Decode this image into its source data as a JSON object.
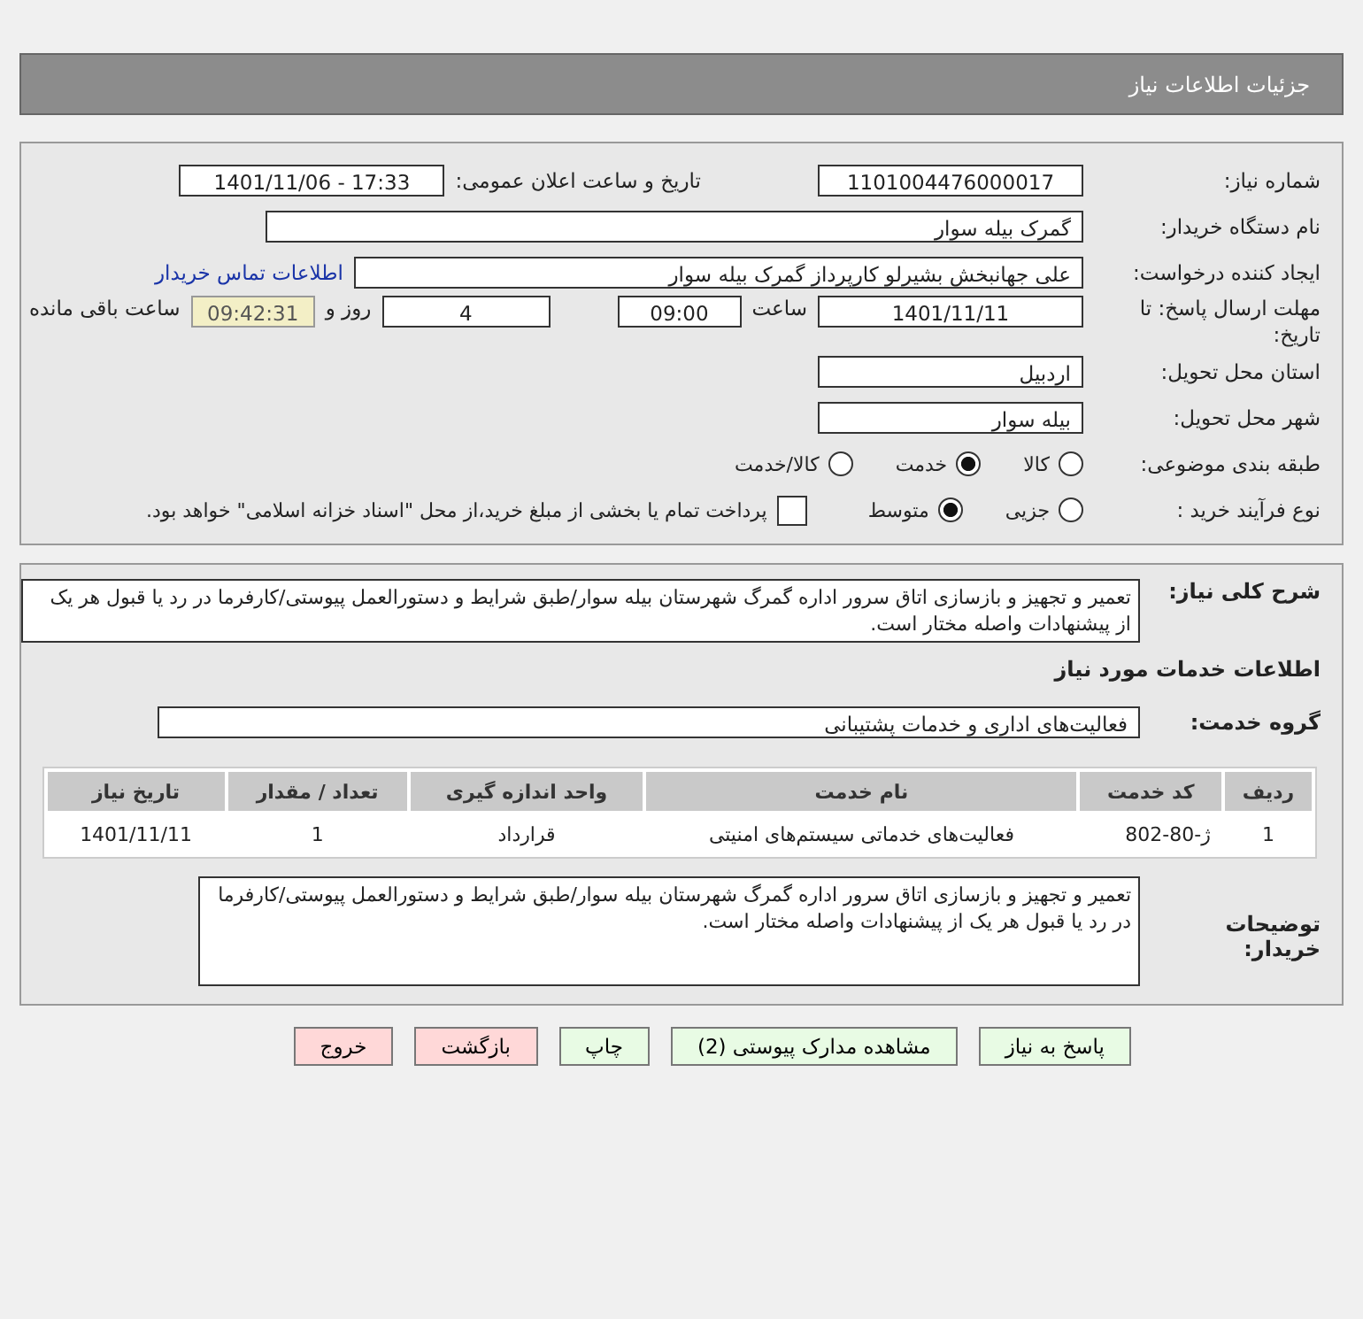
{
  "header": {
    "title": "جزئیات اطلاعات نیاز"
  },
  "need_number": {
    "label": "شماره نیاز:",
    "value": "1101004476000017"
  },
  "announce_date": {
    "label": "تاریخ و ساعت اعلان عمومی:",
    "value": "1401/11/06 - 17:33"
  },
  "buyer_org": {
    "label": "نام دستگاه خریدار:",
    "value": "گمرک بیله سوار"
  },
  "requester": {
    "label": "ایجاد کننده درخواست:",
    "value": "علی جهانبخش بشیرلو کارپرداز گمرک بیله سوار",
    "link": "اطلاعات تماس خریدار"
  },
  "deadline": {
    "label": "مهلت ارسال پاسخ: تا تاریخ:",
    "date": "1401/11/11",
    "time_label": "ساعت",
    "time": "09:00",
    "days": "4",
    "days_label": "روز و",
    "remaining": "09:42:31",
    "remaining_label": "ساعت باقی مانده"
  },
  "province": {
    "label": "استان محل تحویل:",
    "value": "اردبیل"
  },
  "city": {
    "label": "شهر محل تحویل:",
    "value": "بیله سوار"
  },
  "category": {
    "label": "طبقه بندی موضوعی:",
    "options": [
      {
        "label": "کالا",
        "selected": false
      },
      {
        "label": "خدمت",
        "selected": true
      },
      {
        "label": "کالا/خدمت",
        "selected": false
      }
    ]
  },
  "purchase": {
    "label": "نوع فرآیند خرید :",
    "options": [
      {
        "label": "جزیی",
        "selected": false
      },
      {
        "label": "متوسط",
        "selected": true
      }
    ],
    "treasury": {
      "checked": false,
      "text": "پرداخت تمام یا بخشی از مبلغ خرید،از محل \"اسناد خزانه اسلامی\" خواهد بود."
    }
  },
  "description": {
    "label": "شرح کلی نیاز:",
    "value": "تعمیر و تجهیز و بازسازی اتاق سرور اداره گمرگ شهرستان بیله سوار/طبق شرایط و دستورالعمل پیوستی/کارفرما در رد یا قبول هر یک از پیشنهادات واصله مختار است."
  },
  "services_heading": "اطلاعات خدمات مورد نیاز",
  "service_group": {
    "label": "گروه خدمت:",
    "value": "فعالیت‌های اداری و خدمات پشتیبانی"
  },
  "table": {
    "columns": [
      "ردیف",
      "کد خدمت",
      "نام خدمت",
      "واحد اندازه گیری",
      "تعداد / مقدار",
      "تاریخ نیاز"
    ],
    "rows": [
      [
        "1",
        "ژ-80-802",
        "فعالیت‌های خدماتی سیستم‌های امنیتی",
        "قرارداد",
        "1",
        "1401/11/11"
      ]
    ]
  },
  "buyer_notes": {
    "label": "توضیحات خریدار:",
    "value": "تعمیر و تجهیز و بازسازی اتاق سرور اداره گمرگ شهرستان بیله سوار/طبق شرایط و دستورالعمل پیوستی/کارفرما در رد یا قبول هر یک از پیشنهادات واصله مختار است."
  },
  "buttons": [
    {
      "label": "پاسخ به نیاز",
      "kind": "action"
    },
    {
      "label": "مشاهده مدارک پیوستی (2)",
      "kind": "action"
    },
    {
      "label": "چاپ",
      "kind": "action"
    },
    {
      "label": "بازگشت",
      "kind": "exit"
    },
    {
      "label": "خروج",
      "kind": "exit"
    }
  ]
}
